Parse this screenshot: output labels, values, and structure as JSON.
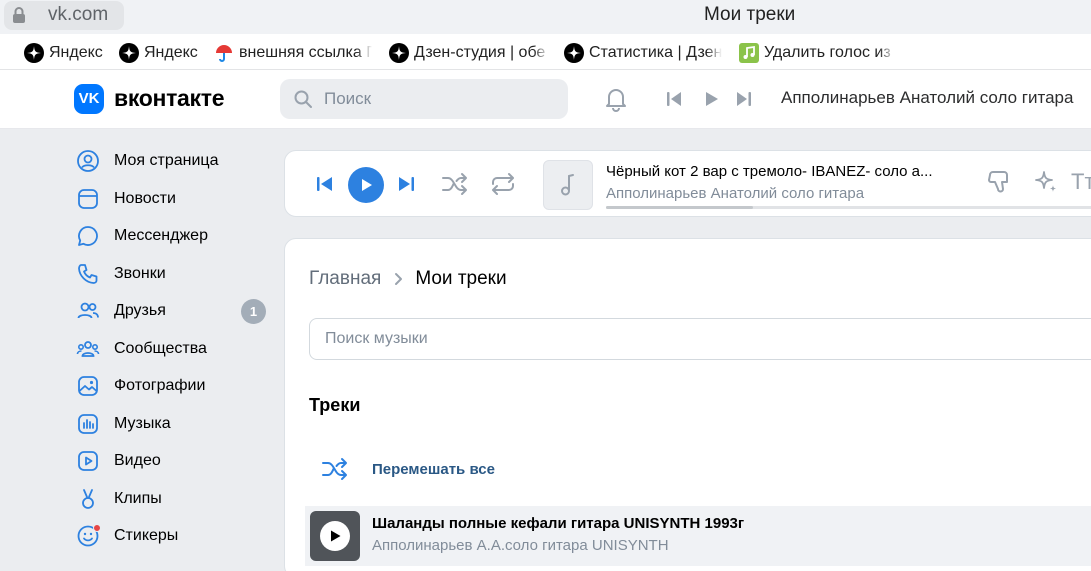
{
  "browser": {
    "url": "vk.com",
    "tab_title": "Мои треки",
    "bookmarks": [
      {
        "label": "Яндекс",
        "icon": "dzen-star-icon"
      },
      {
        "label": "Яндекс",
        "icon": "dzen-star-icon"
      },
      {
        "label": "внешняя ссылка Г",
        "icon": "umbrella-icon"
      },
      {
        "label": "Дзен-студия | обе",
        "icon": "dzen-star-icon"
      },
      {
        "label": "Статистика | Дзен",
        "icon": "dzen-star-icon"
      },
      {
        "label": "Удалить голос из",
        "icon": "music-note-icon"
      }
    ]
  },
  "header": {
    "logo_text": "VK",
    "wordmark": "вконтакте",
    "search_placeholder": "Поиск",
    "now_playing": "Апполинарьев Анатолий соло гитара"
  },
  "sidebar": {
    "items": [
      {
        "label": "Моя страница",
        "icon": "user-circle-icon"
      },
      {
        "label": "Новости",
        "icon": "news-icon"
      },
      {
        "label": "Мессенджер",
        "icon": "message-icon"
      },
      {
        "label": "Звонки",
        "icon": "phone-icon"
      },
      {
        "label": "Друзья",
        "icon": "friends-icon",
        "badge": "1"
      },
      {
        "label": "Сообщества",
        "icon": "communities-icon"
      },
      {
        "label": "Фотографии",
        "icon": "photo-icon"
      },
      {
        "label": "Музыка",
        "icon": "music-icon"
      },
      {
        "label": "Видео",
        "icon": "video-icon"
      },
      {
        "label": "Клипы",
        "icon": "clips-icon"
      },
      {
        "label": "Стикеры",
        "icon": "sticker-icon"
      }
    ]
  },
  "player": {
    "title": "Чёрный кот 2 вар с тремоло- IBANEZ- соло а...",
    "artist": "Апполинарьев Анатолий соло гитара",
    "progress": 0.3,
    "extra_label": "Тт"
  },
  "main": {
    "breadcrumb_home": "Главная",
    "breadcrumb_current": "Мои треки",
    "search_placeholder": "Поиск музыки",
    "section_title": "Треки",
    "shuffle_label": "Перемешать все",
    "tracks": [
      {
        "title": "Шаланды полные кефали гитара UNISYNTH 1993г",
        "artist": "Апполинарьев А.А.соло гитара UNISYNTH"
      }
    ]
  },
  "colors": {
    "accent": "#2d81e0",
    "vk_blue": "#0077ff",
    "link": "#2a5885",
    "muted": "#818c99"
  }
}
